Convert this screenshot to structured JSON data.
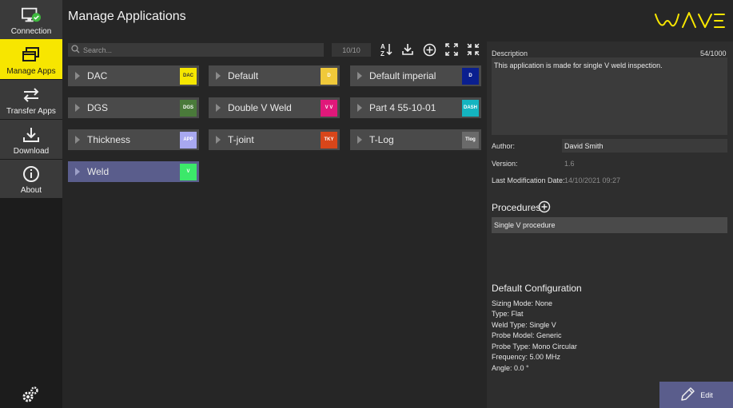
{
  "nav": {
    "items": [
      {
        "label": "Connection",
        "icon": "monitor-check-icon"
      },
      {
        "label": "Manage Apps",
        "icon": "stacked-windows-icon"
      },
      {
        "label": "Transfer Apps",
        "icon": "transfer-arrows-icon"
      },
      {
        "label": "Download",
        "icon": "download-icon"
      },
      {
        "label": "About",
        "icon": "info-icon"
      }
    ],
    "settings_icon": "gears-icon",
    "active_color": "#f7e600"
  },
  "header": {
    "title": "Manage Applications",
    "logo": "WAVE"
  },
  "toolbar": {
    "search_placeholder": "Search...",
    "count": "10/10",
    "icons": [
      "sort-az-icon",
      "download-icon",
      "add-circle-icon",
      "expand-icon",
      "collapse-icon"
    ]
  },
  "apps": [
    {
      "name": "DAC",
      "badge": "DAC",
      "color": "#f5e600",
      "badge_text_color": "#333333"
    },
    {
      "name": "Default",
      "badge": "D",
      "color": "#f0c93a",
      "badge_text_color": "#ffffff"
    },
    {
      "name": "Default imperial",
      "badge": "D",
      "color": "#0a1f8f",
      "badge_text_color": "#ffffff"
    },
    {
      "name": "DGS",
      "badge": "DGS",
      "color": "#4a7a3a",
      "badge_text_color": "#ffffff"
    },
    {
      "name": "Double V Weld",
      "badge": "V V",
      "color": "#e0187a",
      "badge_text_color": "#ffffff"
    },
    {
      "name": "Part 4 55-10-01",
      "badge": "DASH",
      "color": "#14b4c0",
      "badge_text_color": "#ffffff"
    },
    {
      "name": "Thickness",
      "badge": "APP",
      "color": "#a8a8f0",
      "badge_text_color": "#ffffff"
    },
    {
      "name": "T-joint",
      "badge": "TKY",
      "color": "#d8461a",
      "badge_text_color": "#ffffff"
    },
    {
      "name": "T-Log",
      "badge": "Tlog",
      "color": "#6a6a6a",
      "badge_text_color": "#ffffff"
    },
    {
      "name": "Weld",
      "badge": "V",
      "color": "#3ce86a",
      "badge_text_color": "#ffffff",
      "selected": true
    }
  ],
  "details": {
    "description_label": "Description",
    "description_count": "54/1000",
    "description": "This application is made for single V weld inspection.",
    "author_label": "Author:",
    "author": "David Smith",
    "version_label": "Version:",
    "version": "1.6",
    "modified_label": "Last Modification Date:",
    "modified": "14/10/2021 09:27",
    "procedures_title": "Procedures",
    "procedures": [
      "Single V procedure"
    ],
    "config_title": "Default Configuration",
    "config": [
      "Sizing Mode: None",
      "Type: Flat",
      "Weld Type: Single V",
      "Probe Model: Generic",
      "Probe Type: Mono Circular",
      "Frequency: 5.00 MHz",
      "Angle: 0.0 °"
    ],
    "edit_label": "Edit"
  }
}
